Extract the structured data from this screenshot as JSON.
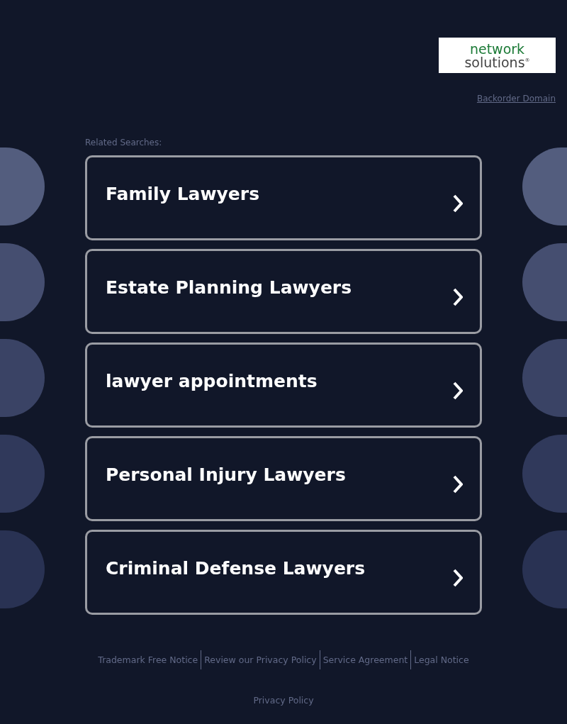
{
  "logo": {
    "line_1": "network",
    "line_2": "solutions",
    "mark": "®"
  },
  "backorder_link": "Backorder Domain",
  "related_searches": {
    "title": "Related Searches:",
    "items": [
      {
        "label": "Family Lawyers"
      },
      {
        "label": "Estate Planning Lawyers"
      },
      {
        "label": "lawyer appointments"
      },
      {
        "label": "Personal Injury Lawyers"
      },
      {
        "label": "Criminal Defense Lawyers"
      }
    ]
  },
  "footer_links": [
    "Trademark Free Notice",
    "Review our Privacy Policy",
    "Service Agreement",
    "Legal Notice"
  ],
  "privacy_policy": "Privacy Policy"
}
